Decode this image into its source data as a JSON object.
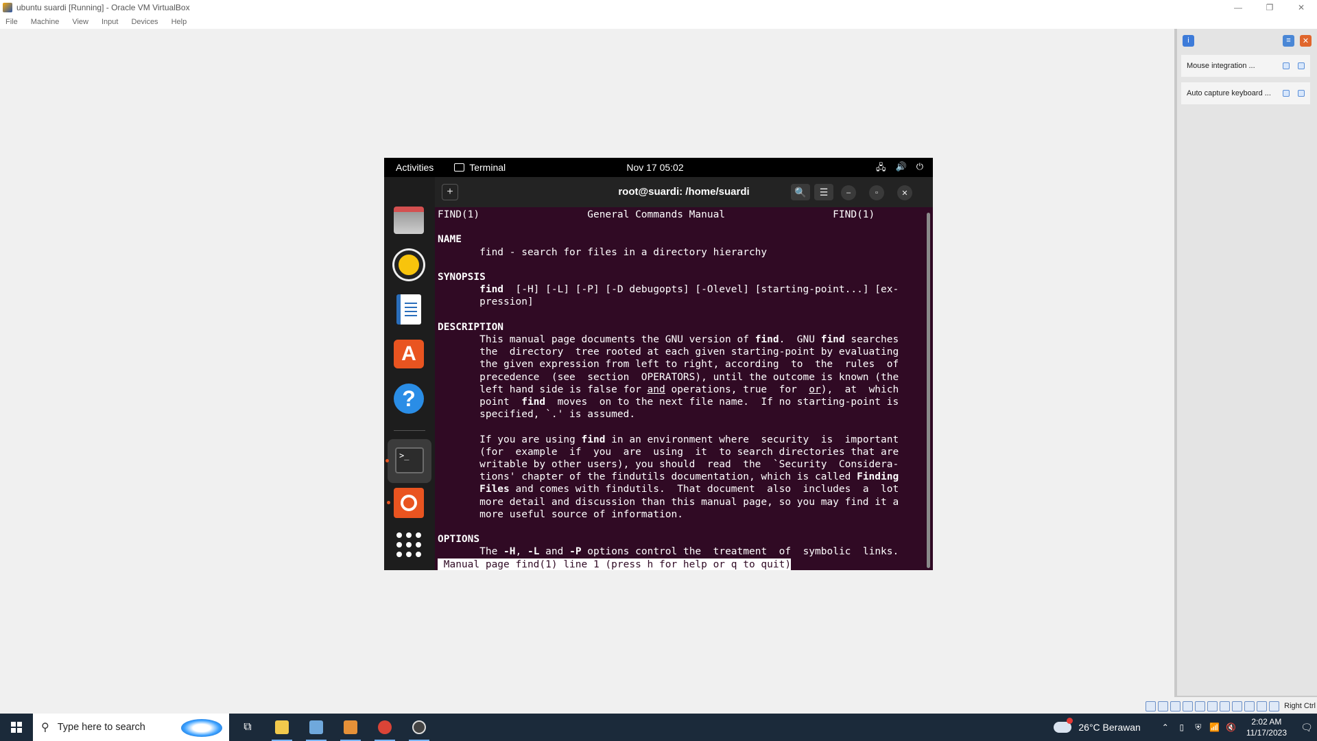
{
  "host": {
    "title": "ubuntu suardi [Running] - Oracle VM VirtualBox",
    "menu": [
      "File",
      "Machine",
      "View",
      "Input",
      "Devices",
      "Help"
    ],
    "window_controls": {
      "minimize": "—",
      "restore": "❐",
      "close": "✕"
    }
  },
  "notifications": {
    "items": [
      {
        "label": "Mouse integration ..."
      },
      {
        "label": "Auto capture keyboard ..."
      }
    ],
    "right_ctrl": "Right Ctrl"
  },
  "guest": {
    "topbar": {
      "activities": "Activities",
      "app": "Terminal",
      "clock": "Nov 17  05:02",
      "tray": {
        "network": "🖧",
        "volume": "🔊",
        "power": "⏻"
      }
    },
    "dock": {
      "items": [
        {
          "name": "files"
        },
        {
          "name": "rhythmbox"
        },
        {
          "name": "libreoffice-writer"
        },
        {
          "name": "ubuntu-software"
        },
        {
          "name": "help"
        },
        {
          "name": "terminal",
          "glyph": ">_"
        },
        {
          "name": "ubuntu-installer"
        },
        {
          "name": "show-applications"
        }
      ]
    },
    "terminal": {
      "title": "root@suardi: /home/suardi",
      "new_tab": "+",
      "search": "🔍",
      "menu": "☰",
      "minimize": "–",
      "maximize": "▫",
      "close": "✕",
      "lines": [
        {
          "segs": [
            {
              "t": "FIND(1)                  General Commands Manual                  FIND(1)"
            }
          ]
        },
        {
          "segs": [
            {
              "t": ""
            }
          ]
        },
        {
          "segs": [
            {
              "t": "NAME",
              "b": true
            }
          ]
        },
        {
          "segs": [
            {
              "t": "       find - search for files in a directory hierarchy"
            }
          ]
        },
        {
          "segs": [
            {
              "t": ""
            }
          ]
        },
        {
          "segs": [
            {
              "t": "SYNOPSIS",
              "b": true
            }
          ]
        },
        {
          "segs": [
            {
              "t": "       "
            },
            {
              "t": "find",
              "b": true
            },
            {
              "t": "  [-H] [-L] [-P] [-D debugopts] [-Olevel] [starting-point...] [ex‐"
            }
          ]
        },
        {
          "segs": [
            {
              "t": "       pression]"
            }
          ]
        },
        {
          "segs": [
            {
              "t": ""
            }
          ]
        },
        {
          "segs": [
            {
              "t": "DESCRIPTION",
              "b": true
            }
          ]
        },
        {
          "segs": [
            {
              "t": "       This manual page documents the GNU version of "
            },
            {
              "t": "find",
              "b": true
            },
            {
              "t": ".  GNU "
            },
            {
              "t": "find",
              "b": true
            },
            {
              "t": " searches"
            }
          ]
        },
        {
          "segs": [
            {
              "t": "       the  directory  tree rooted at each given starting-point by evaluating"
            }
          ]
        },
        {
          "segs": [
            {
              "t": "       the given expression from left to right, according  to  the  rules  of"
            }
          ]
        },
        {
          "segs": [
            {
              "t": "       precedence  (see  section  OPERATORS), until the outcome is known (the"
            }
          ]
        },
        {
          "segs": [
            {
              "t": "       left hand side is false for "
            },
            {
              "t": "and",
              "u": true
            },
            {
              "t": " operations, true  for  "
            },
            {
              "t": "or",
              "u": true
            },
            {
              "t": "),  at  which"
            }
          ]
        },
        {
          "segs": [
            {
              "t": "       point  "
            },
            {
              "t": "find",
              "b": true
            },
            {
              "t": "  moves  on to the next file name.  If no starting-point is"
            }
          ]
        },
        {
          "segs": [
            {
              "t": "       specified, `.' is assumed."
            }
          ]
        },
        {
          "segs": [
            {
              "t": ""
            }
          ]
        },
        {
          "segs": [
            {
              "t": "       If you are using "
            },
            {
              "t": "find",
              "b": true
            },
            {
              "t": " in an environment where  security  is  important"
            }
          ]
        },
        {
          "segs": [
            {
              "t": "       (for  example  if  you  are  using  it  to search directories that are"
            }
          ]
        },
        {
          "segs": [
            {
              "t": "       writable by other users), you should  read  the  `Security  Considera‐"
            }
          ]
        },
        {
          "segs": [
            {
              "t": "       tions' chapter of the findutils documentation, which is called "
            },
            {
              "t": "Finding",
              "b": true
            }
          ]
        },
        {
          "segs": [
            {
              "t": "       "
            },
            {
              "t": "Files",
              "b": true
            },
            {
              "t": " and comes with findutils.  That document  also  includes  a  lot"
            }
          ]
        },
        {
          "segs": [
            {
              "t": "       more detail and discussion than this manual page, so you may find it a"
            }
          ]
        },
        {
          "segs": [
            {
              "t": "       more useful source of information."
            }
          ]
        },
        {
          "segs": [
            {
              "t": ""
            }
          ]
        },
        {
          "segs": [
            {
              "t": "OPTIONS",
              "b": true
            }
          ]
        },
        {
          "segs": [
            {
              "t": "       The "
            },
            {
              "t": "-H",
              "b": true
            },
            {
              "t": ", "
            },
            {
              "t": "-L",
              "b": true
            },
            {
              "t": " and "
            },
            {
              "t": "-P",
              "b": true
            },
            {
              "t": " options control the  treatment  of  symbolic  links."
            }
          ]
        }
      ],
      "status_line": " Manual page find(1) line 1 (press h for help or q to quit)"
    }
  },
  "taskbar": {
    "search_placeholder": "Type here to search",
    "weather": "26°C  Berawan",
    "time": "2:02 AM",
    "date": "11/17/2023",
    "apps": [
      {
        "name": "task-view",
        "color": "#1b2a3a"
      },
      {
        "name": "file-explorer",
        "color": "#f2c94c"
      },
      {
        "name": "virtualbox",
        "color": "#6fa8dc"
      },
      {
        "name": "paint",
        "color": "#e69138"
      },
      {
        "name": "chrome",
        "color": "#db4437"
      },
      {
        "name": "obs",
        "color": "#444444"
      }
    ]
  }
}
